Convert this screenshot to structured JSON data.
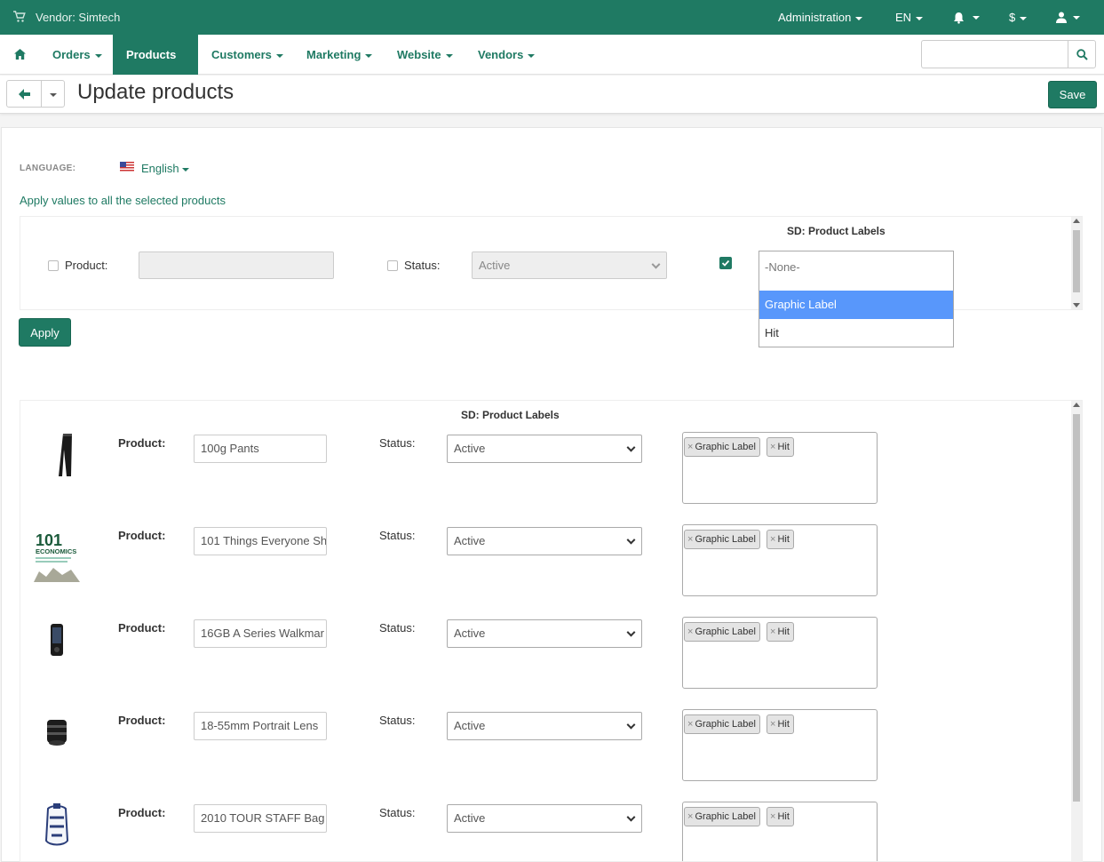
{
  "topbar": {
    "vendor": "Vendor: Simtech",
    "administration": "Administration",
    "language": "EN",
    "currency": "$"
  },
  "nav": {
    "items": [
      "Orders",
      "Products",
      "Customers",
      "Marketing",
      "Website",
      "Vendors"
    ],
    "active": "Products",
    "search_placeholder": ""
  },
  "title": {
    "text": "Update products",
    "save_label": "Save"
  },
  "language": {
    "label": "LANGUAGE:",
    "value": "English"
  },
  "apply_all": {
    "heading": "Apply values to all the selected products",
    "product_label": "Product:",
    "status_label": "Status:",
    "status_value": "Active",
    "labels_column": "SD: Product Labels",
    "labels_dropdown": {
      "none": "-None-",
      "options": [
        "Graphic Label",
        "Hit"
      ],
      "highlighted": "Graphic Label"
    },
    "apply_label": "Apply"
  },
  "products": {
    "labels_column": "SD: Product Labels",
    "product_label": "Product:",
    "status_label": "Status:",
    "rows": [
      {
        "name": "100g Pants",
        "status": "Active",
        "tags": [
          "Graphic Label",
          "Hit"
        ]
      },
      {
        "name": "101 Things Everyone Sh",
        "status": "Active",
        "tags": [
          "Graphic Label",
          "Hit"
        ]
      },
      {
        "name": "16GB A Series Walkmar",
        "status": "Active",
        "tags": [
          "Graphic Label",
          "Hit"
        ]
      },
      {
        "name": "18-55mm Portrait Lens",
        "status": "Active",
        "tags": [
          "Graphic Label",
          "Hit"
        ]
      },
      {
        "name": "2010 TOUR STAFF Bag",
        "status": "Active",
        "tags": [
          "Graphic Label",
          "Hit"
        ]
      }
    ],
    "thumb_101_text": [
      "101",
      "ECONOMICS"
    ]
  },
  "colors": {
    "brand": "#1f7a63",
    "highlight": "#5897fb"
  },
  "icons": [
    "cart-icon",
    "home-icon",
    "search-icon",
    "bell-icon",
    "user-icon",
    "arrow-left-icon",
    "flag-us-icon"
  ]
}
